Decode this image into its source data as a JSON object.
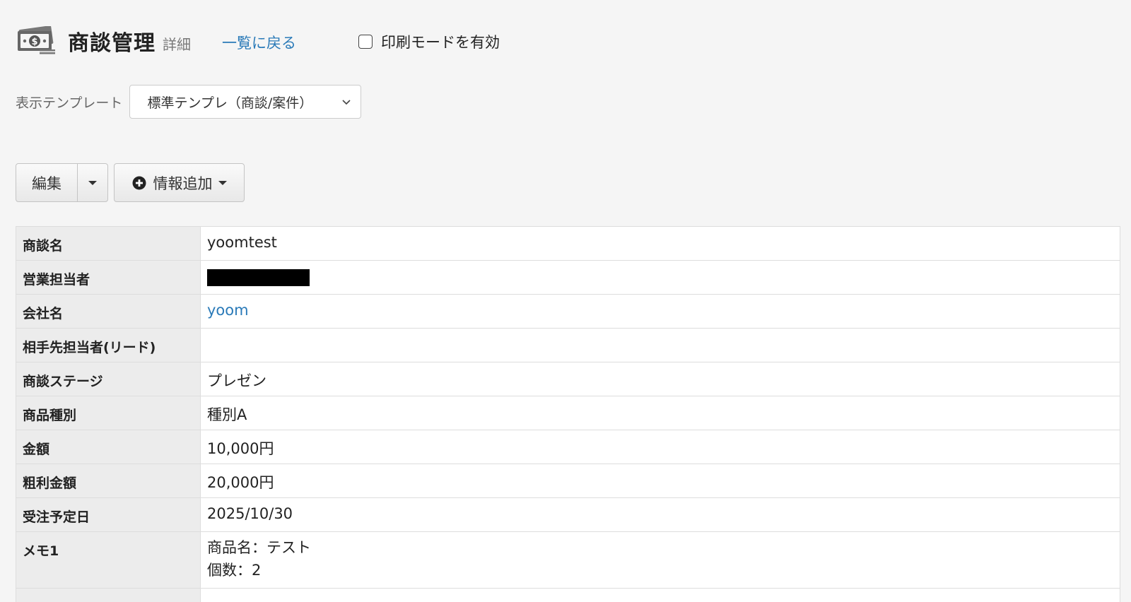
{
  "header": {
    "icon": "money-bill-icon",
    "title": "商談管理",
    "subtitle": "詳細",
    "back_link": "一覧に戻る",
    "print_mode_label": "印刷モードを有効",
    "print_mode_checked": false
  },
  "template": {
    "label": "表示テンプレート",
    "selected": "標準テンプレ（商談/案件）"
  },
  "toolbar": {
    "edit_label": "編集",
    "add_info_label": "情報追加"
  },
  "detail": {
    "rows": [
      {
        "label": "商談名",
        "value": "yoomtest"
      },
      {
        "label": "営業担当者",
        "value": ""
      },
      {
        "label": "会社名",
        "value": "yoom"
      },
      {
        "label": "相手先担当者(リード)",
        "value": ""
      },
      {
        "label": "商談ステージ",
        "value": "プレゼン"
      },
      {
        "label": "商品種別",
        "value": "種別A"
      },
      {
        "label": "金額",
        "value": "10,000円"
      },
      {
        "label": "粗利金額",
        "value": "20,000円"
      },
      {
        "label": "受注予定日",
        "value": "2025/10/30"
      },
      {
        "label": "メモ1",
        "lines": [
          "商品名：テスト",
          "個数：2"
        ]
      }
    ]
  },
  "colors": {
    "link": "#2a7ab8",
    "background": "#f5f5f5",
    "label_cell": "#ececec"
  }
}
